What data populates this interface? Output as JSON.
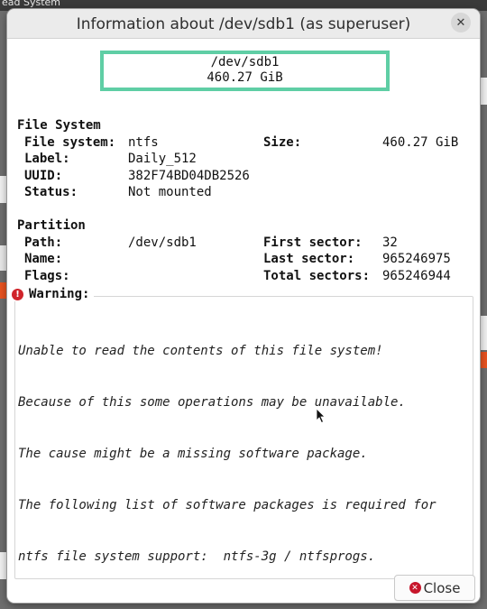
{
  "background": {
    "top_text": "ead System"
  },
  "dialog": {
    "title": "Information about /dev/sdb1 (as superuser)",
    "close_glyph": "✕",
    "device": {
      "path": "/dev/sdb1",
      "size": "460.27 GiB"
    },
    "file_system": {
      "heading": "File System",
      "rows": [
        {
          "label": "File system:",
          "value": "ntfs"
        },
        {
          "label": "Label:",
          "value": "Daily_512"
        },
        {
          "label": "UUID:",
          "value": "382F74BD04DB2526"
        },
        {
          "label": "Status:",
          "value": "Not mounted"
        }
      ],
      "size_label": "Size:",
      "size_value": "460.27 GiB"
    },
    "partition": {
      "heading": "Partition",
      "rows": [
        {
          "label": "Path:",
          "value": "/dev/sdb1"
        },
        {
          "label": "Name:",
          "value": ""
        },
        {
          "label": "Flags:",
          "value": ""
        }
      ],
      "right_rows": [
        {
          "label": "First sector:",
          "value": "32"
        },
        {
          "label": "Last sector:",
          "value": "965246975"
        },
        {
          "label": "Total sectors:",
          "value": "965246944"
        }
      ]
    },
    "warning": {
      "heading": "Warning:",
      "icon": "!",
      "lines": [
        "Unable to read the contents of this file system!",
        "Because of this some operations may be unavailable.",
        "The cause might be a missing software package.",
        "The following list of software packages is required for",
        "ntfs file system support:  ntfs-3g / ntfsprogs."
      ]
    },
    "close_button": {
      "label": "Close",
      "icon": "close-icon"
    },
    "colors": {
      "device_border": "#5fcea5",
      "warning_icon": "#d0242a",
      "close_icon": "#c7162b"
    }
  }
}
